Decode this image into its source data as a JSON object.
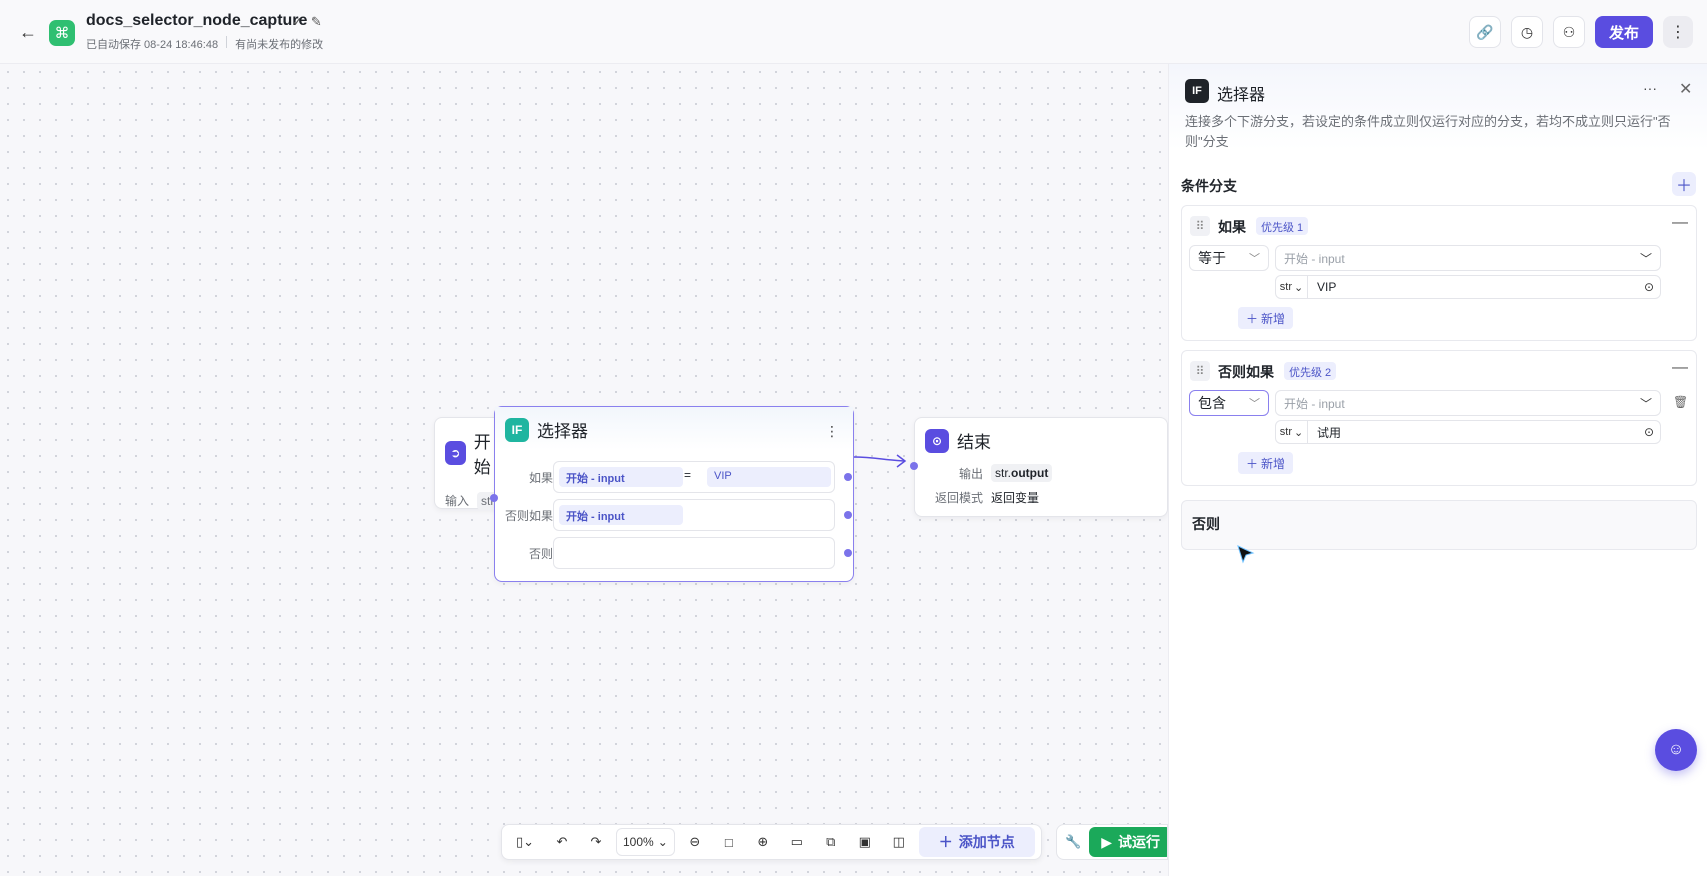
{
  "header": {
    "title": "docs_selector_node_capture",
    "autosave": "已自动保存 08-24 18:46:48",
    "unpublished": "有尚未发布的修改",
    "publish_label": "发布",
    "logo_glyph": "⌘"
  },
  "canvas": {
    "start_node": {
      "title": "开始",
      "input_label": "输入",
      "type_tag": "str"
    },
    "selector_node": {
      "icon": "IF",
      "title": "选择器",
      "rows": [
        {
          "label": "如果",
          "left": "开始 - input",
          "op": "=",
          "right": "VIP"
        },
        {
          "label": "否则如果",
          "left": "开始 - input"
        },
        {
          "label": "否则"
        }
      ]
    },
    "end_node": {
      "title": "结束",
      "output_label": "输出",
      "output_type": "str.",
      "output_name": "output",
      "mode_label": "返回模式",
      "mode_value": "返回变量"
    }
  },
  "toolbar": {
    "zoom": "100%",
    "add_node_label": "添加节点",
    "trial_label": "试运行"
  },
  "panel": {
    "icon": "IF",
    "title": "选择器",
    "description": "连接多个下游分支，若设定的条件成立则仅运行对应的分支，若均不成立则只运行\"否则\"分支",
    "section_title": "条件分支",
    "branches": [
      {
        "name": "如果",
        "priority": "优先级 1",
        "operator": "等于",
        "left_placeholder": "开始 - input",
        "type": "str",
        "value": "VIP",
        "add_label": "新增"
      },
      {
        "name": "否则如果",
        "priority": "优先级 2",
        "operator": "包含",
        "left_placeholder": "开始 - input",
        "type": "str",
        "value": "试用",
        "add_label": "新增"
      }
    ],
    "else_label": "否则"
  },
  "colors": {
    "accent": "#5a4de0",
    "green": "#1ba95a",
    "logo": "#2fbf71"
  }
}
